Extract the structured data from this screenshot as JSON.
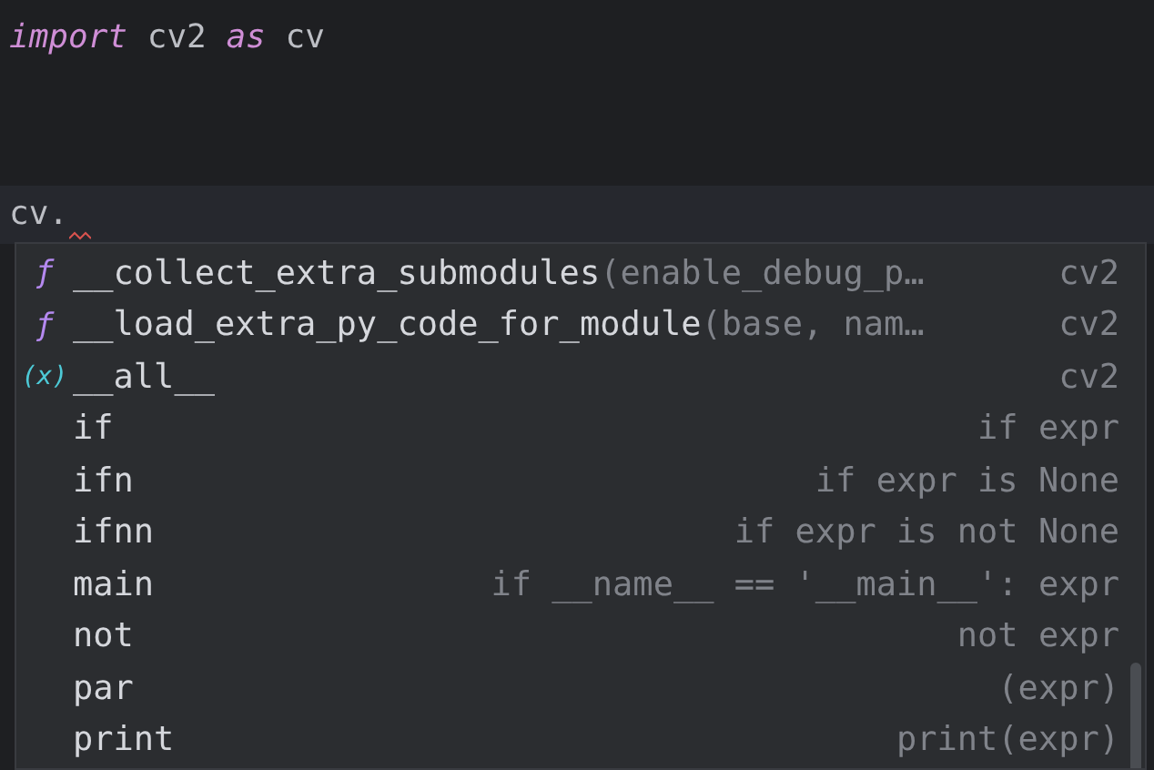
{
  "editor": {
    "lines": [
      {
        "tokens": [
          {
            "text": "import",
            "kind": "keyword"
          },
          {
            "text": " cv2 ",
            "kind": "plain"
          },
          {
            "text": "as",
            "kind": "keyword"
          },
          {
            "text": " cv",
            "kind": "plain"
          }
        ],
        "current": false
      },
      {
        "tokens": [
          {
            "text": "cv.",
            "kind": "plain"
          }
        ],
        "current": true
      }
    ]
  },
  "completion": {
    "items": [
      {
        "kind": "function",
        "icon": "ƒ",
        "name": "__collect_extra_submodules",
        "params": "(enable_debug_p…",
        "type": "cv2",
        "selected": false
      },
      {
        "kind": "function",
        "icon": "ƒ",
        "name": "__load_extra_py_code_for_module",
        "params": "(base, nam…",
        "type": "cv2",
        "selected": false
      },
      {
        "kind": "variable",
        "icon": "(x)",
        "name": "__all__",
        "type": "cv2",
        "selected": false
      },
      {
        "kind": "template",
        "name": "if",
        "hint": "if expr",
        "selected": false
      },
      {
        "kind": "template",
        "name": "ifn",
        "hint": "if expr is None",
        "selected": false
      },
      {
        "kind": "template",
        "name": "ifnn",
        "hint": "if expr is not None",
        "selected": false
      },
      {
        "kind": "template",
        "name": "main",
        "hint": "if __name__ == '__main__': expr",
        "selected": false
      },
      {
        "kind": "template",
        "name": "not",
        "hint": "not expr",
        "selected": false
      },
      {
        "kind": "template",
        "name": "par",
        "hint": "(expr)",
        "selected": false
      },
      {
        "kind": "template",
        "name": "print",
        "hint": "print(expr)",
        "selected": false
      }
    ]
  }
}
